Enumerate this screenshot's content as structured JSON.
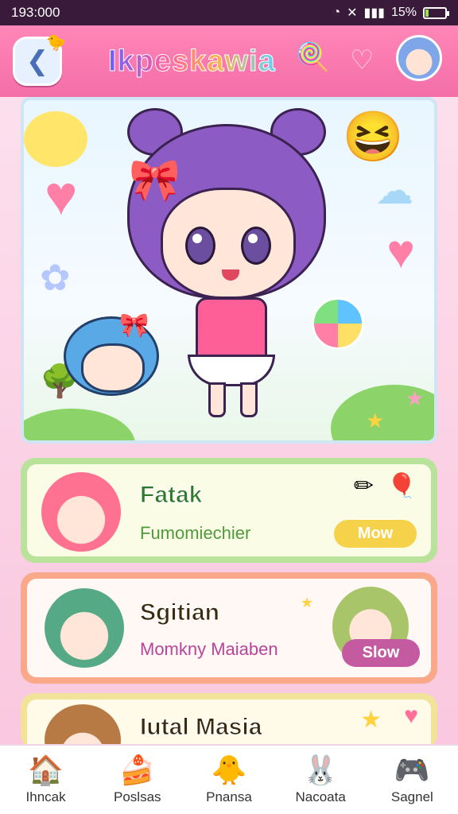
{
  "status_bar": {
    "time": "193:000",
    "battery": "15%",
    "battery_level": 0.15
  },
  "header": {
    "title": "Ikpeskawia"
  },
  "icons": {
    "back": "back-arrow-icon",
    "lollipop": "heart-lollipop-icon",
    "bubble": "chat-bubble-icon",
    "profile": "avatar"
  },
  "cards": [
    {
      "title": "Fatak",
      "subtitle": "Fumomiechier",
      "button": "Mow"
    },
    {
      "title": "Sgitian",
      "subtitle": "Momkny Maiaben",
      "button": "Slow"
    },
    {
      "title": "Iutal Masia"
    }
  ],
  "nav": [
    {
      "label": "Ihncak",
      "icon": "house-icon"
    },
    {
      "label": "Poslsas",
      "icon": "cake-icon"
    },
    {
      "label": "Pnansa",
      "icon": "chick-icon"
    },
    {
      "label": "Nacoata",
      "icon": "bunny-icon"
    },
    {
      "label": "Sagnel",
      "icon": "game-icon"
    }
  ]
}
